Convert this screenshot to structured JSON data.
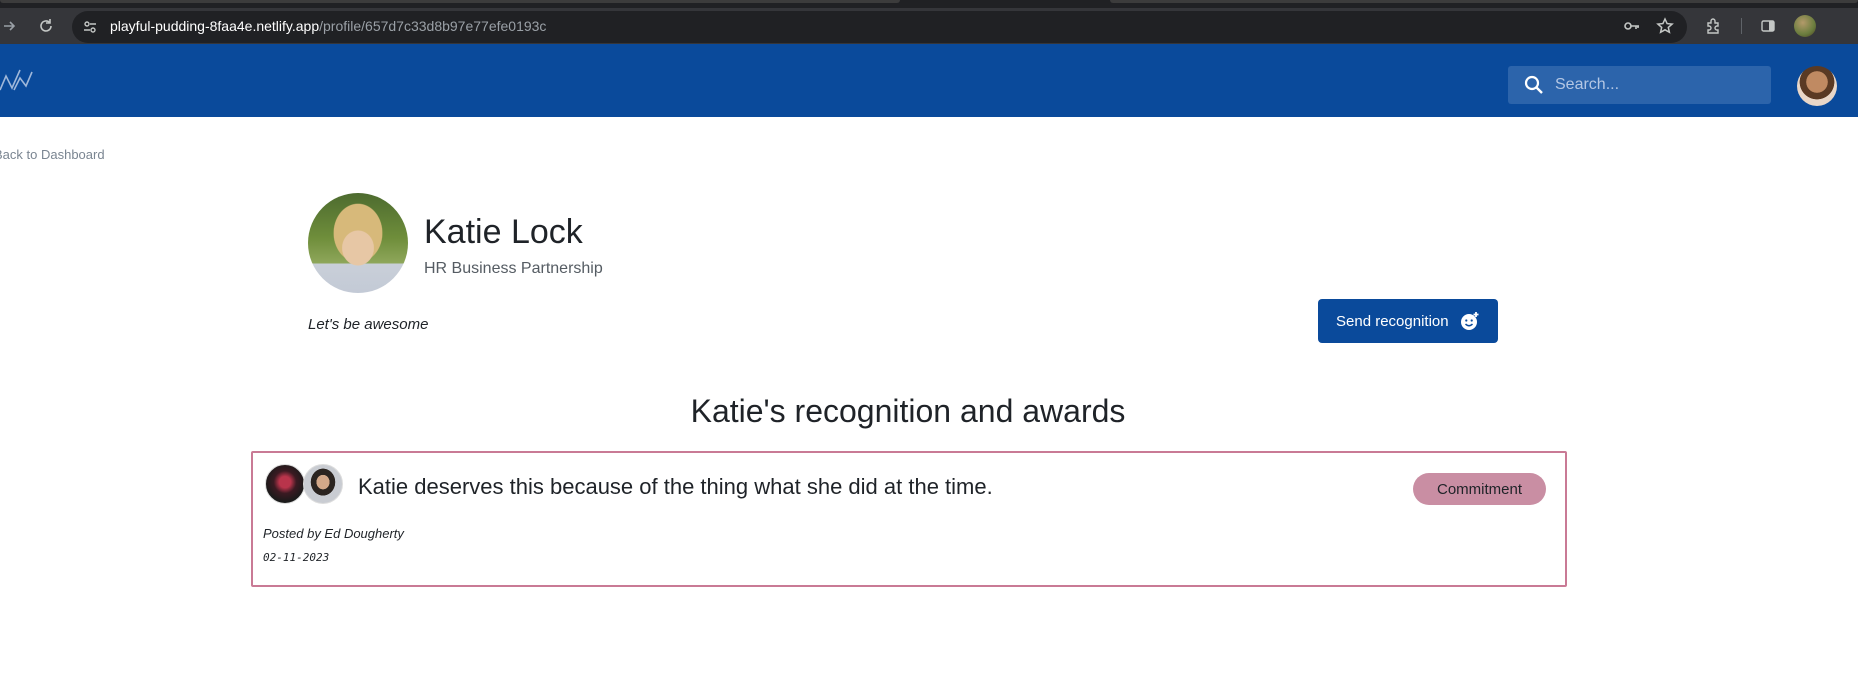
{
  "browser": {
    "url_host": "playful-pudding-8faa4e.netlify.app",
    "url_path": "/profile/657d7c33d8b97e77efe0193c",
    "icons": [
      "forward-icon",
      "reload-icon",
      "site-settings-icon",
      "password-key-icon",
      "bookmark-star-icon",
      "extensions-icon",
      "side-panel-icon",
      "profile-avatar"
    ]
  },
  "header": {
    "logo": "app-logo",
    "search": {
      "placeholder": "Search..."
    },
    "brand_color": "#0a4a9b"
  },
  "nav": {
    "back_label": "Back to Dashboard"
  },
  "profile": {
    "name": "Katie Lock",
    "department": "HR Business Partnership",
    "motto": "Let's be awesome",
    "send_button_label": "Send recognition"
  },
  "recognitions": {
    "title": "Katie's recognition and awards",
    "items": [
      {
        "message": "Katie deserves this because of the thing what she did at the time.",
        "badge": "Commitment",
        "posted_by": "Posted by Ed Dougherty",
        "date": "02-11-2023"
      }
    ]
  },
  "colors": {
    "card_border": "#c97a95",
    "badge_bg": "#c98ea3"
  }
}
